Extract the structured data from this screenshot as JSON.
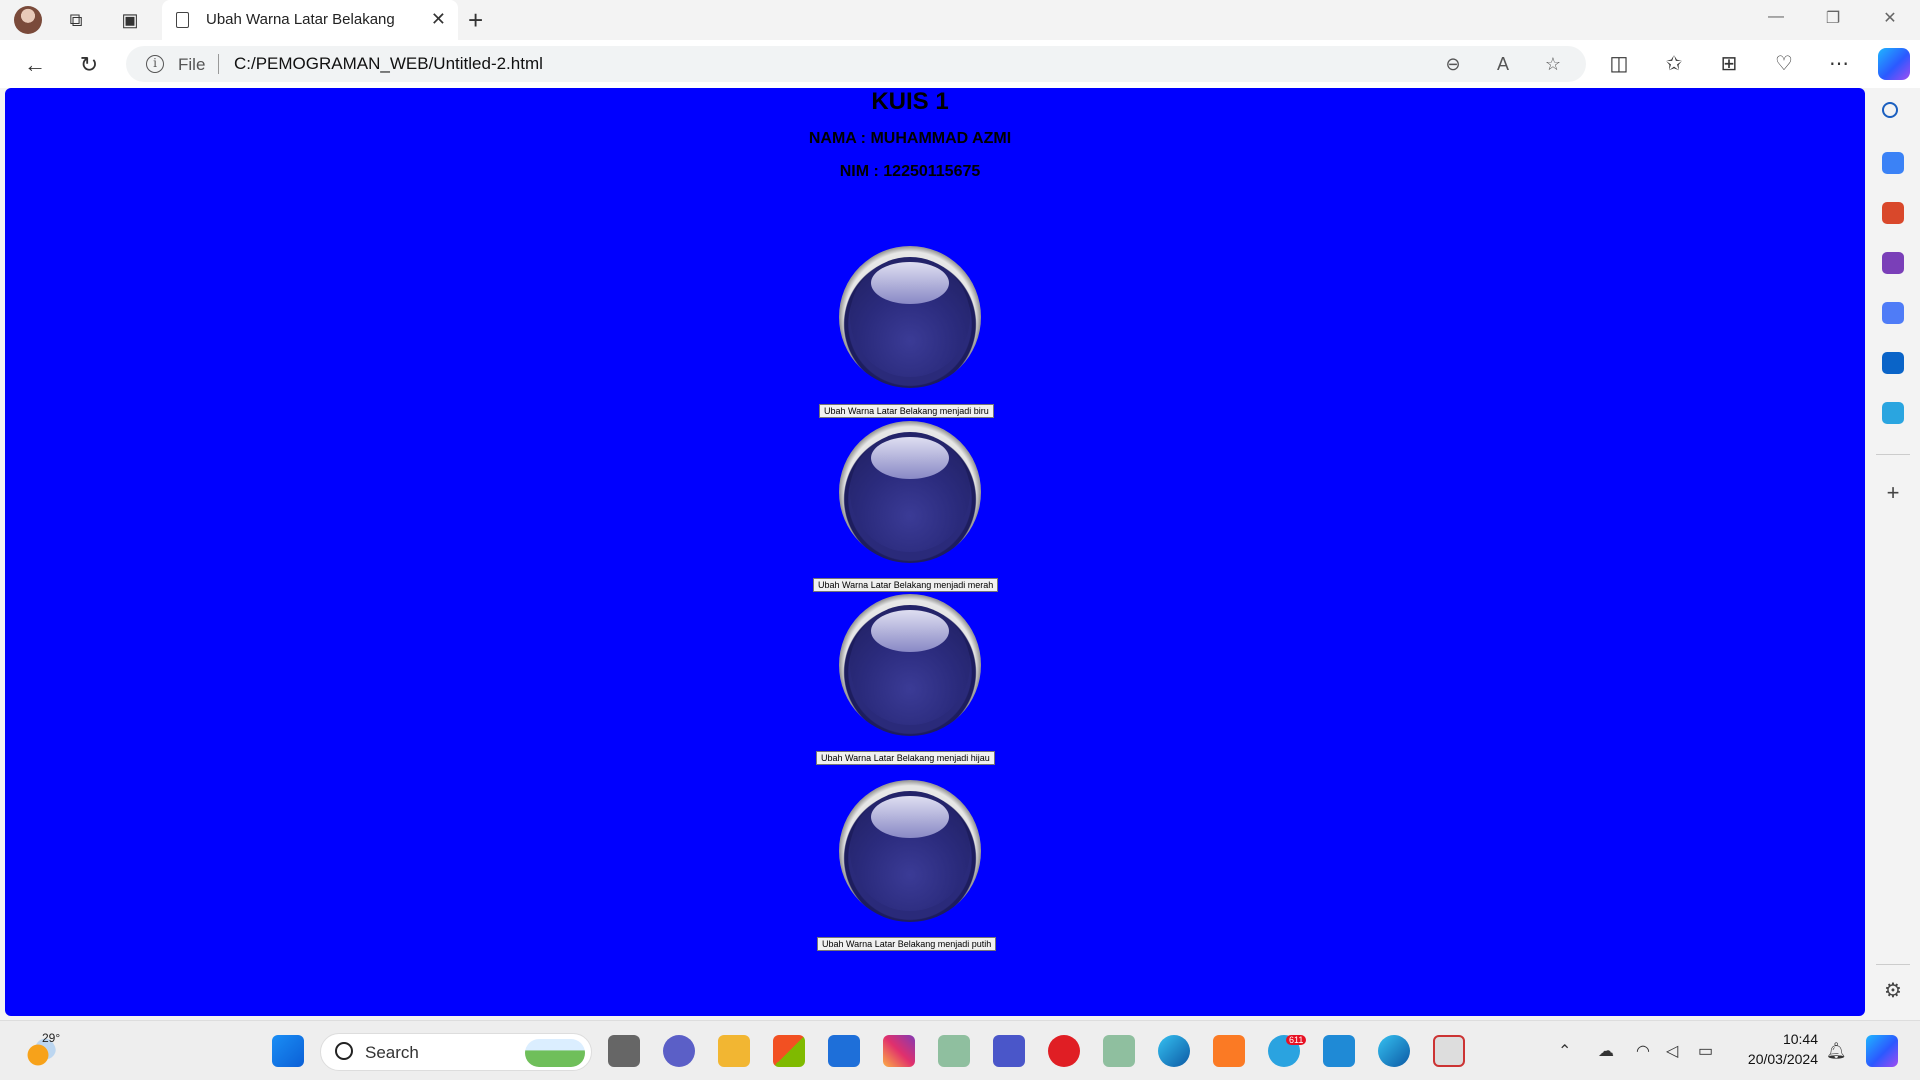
{
  "browser": {
    "tab_title": "Ubah Warna Latar Belakang",
    "address_scheme": "File",
    "url": "C:/PEMOGRAMAN_WEB/Untitled-2.html"
  },
  "page": {
    "background_color": "#0000ff",
    "heading": "KUIS 1",
    "name_line": "NAMA : MUHAMMAD AZMI",
    "nim_line": "NIM : 12250115675",
    "buttons": [
      {
        "label": "Ubah Warna Latar Belakang menjadi biru"
      },
      {
        "label": "Ubah Warna Latar Belakang menjadi merah"
      },
      {
        "label": "Ubah Warna Latar Belakang menjadi hijau"
      },
      {
        "label": "Ubah Warna Latar Belakang menjadi putih"
      }
    ]
  },
  "taskbar": {
    "temperature": "29°",
    "search_placeholder": "Search",
    "telegram_badge": "611",
    "time": "10:44",
    "date": "20/03/2024"
  }
}
